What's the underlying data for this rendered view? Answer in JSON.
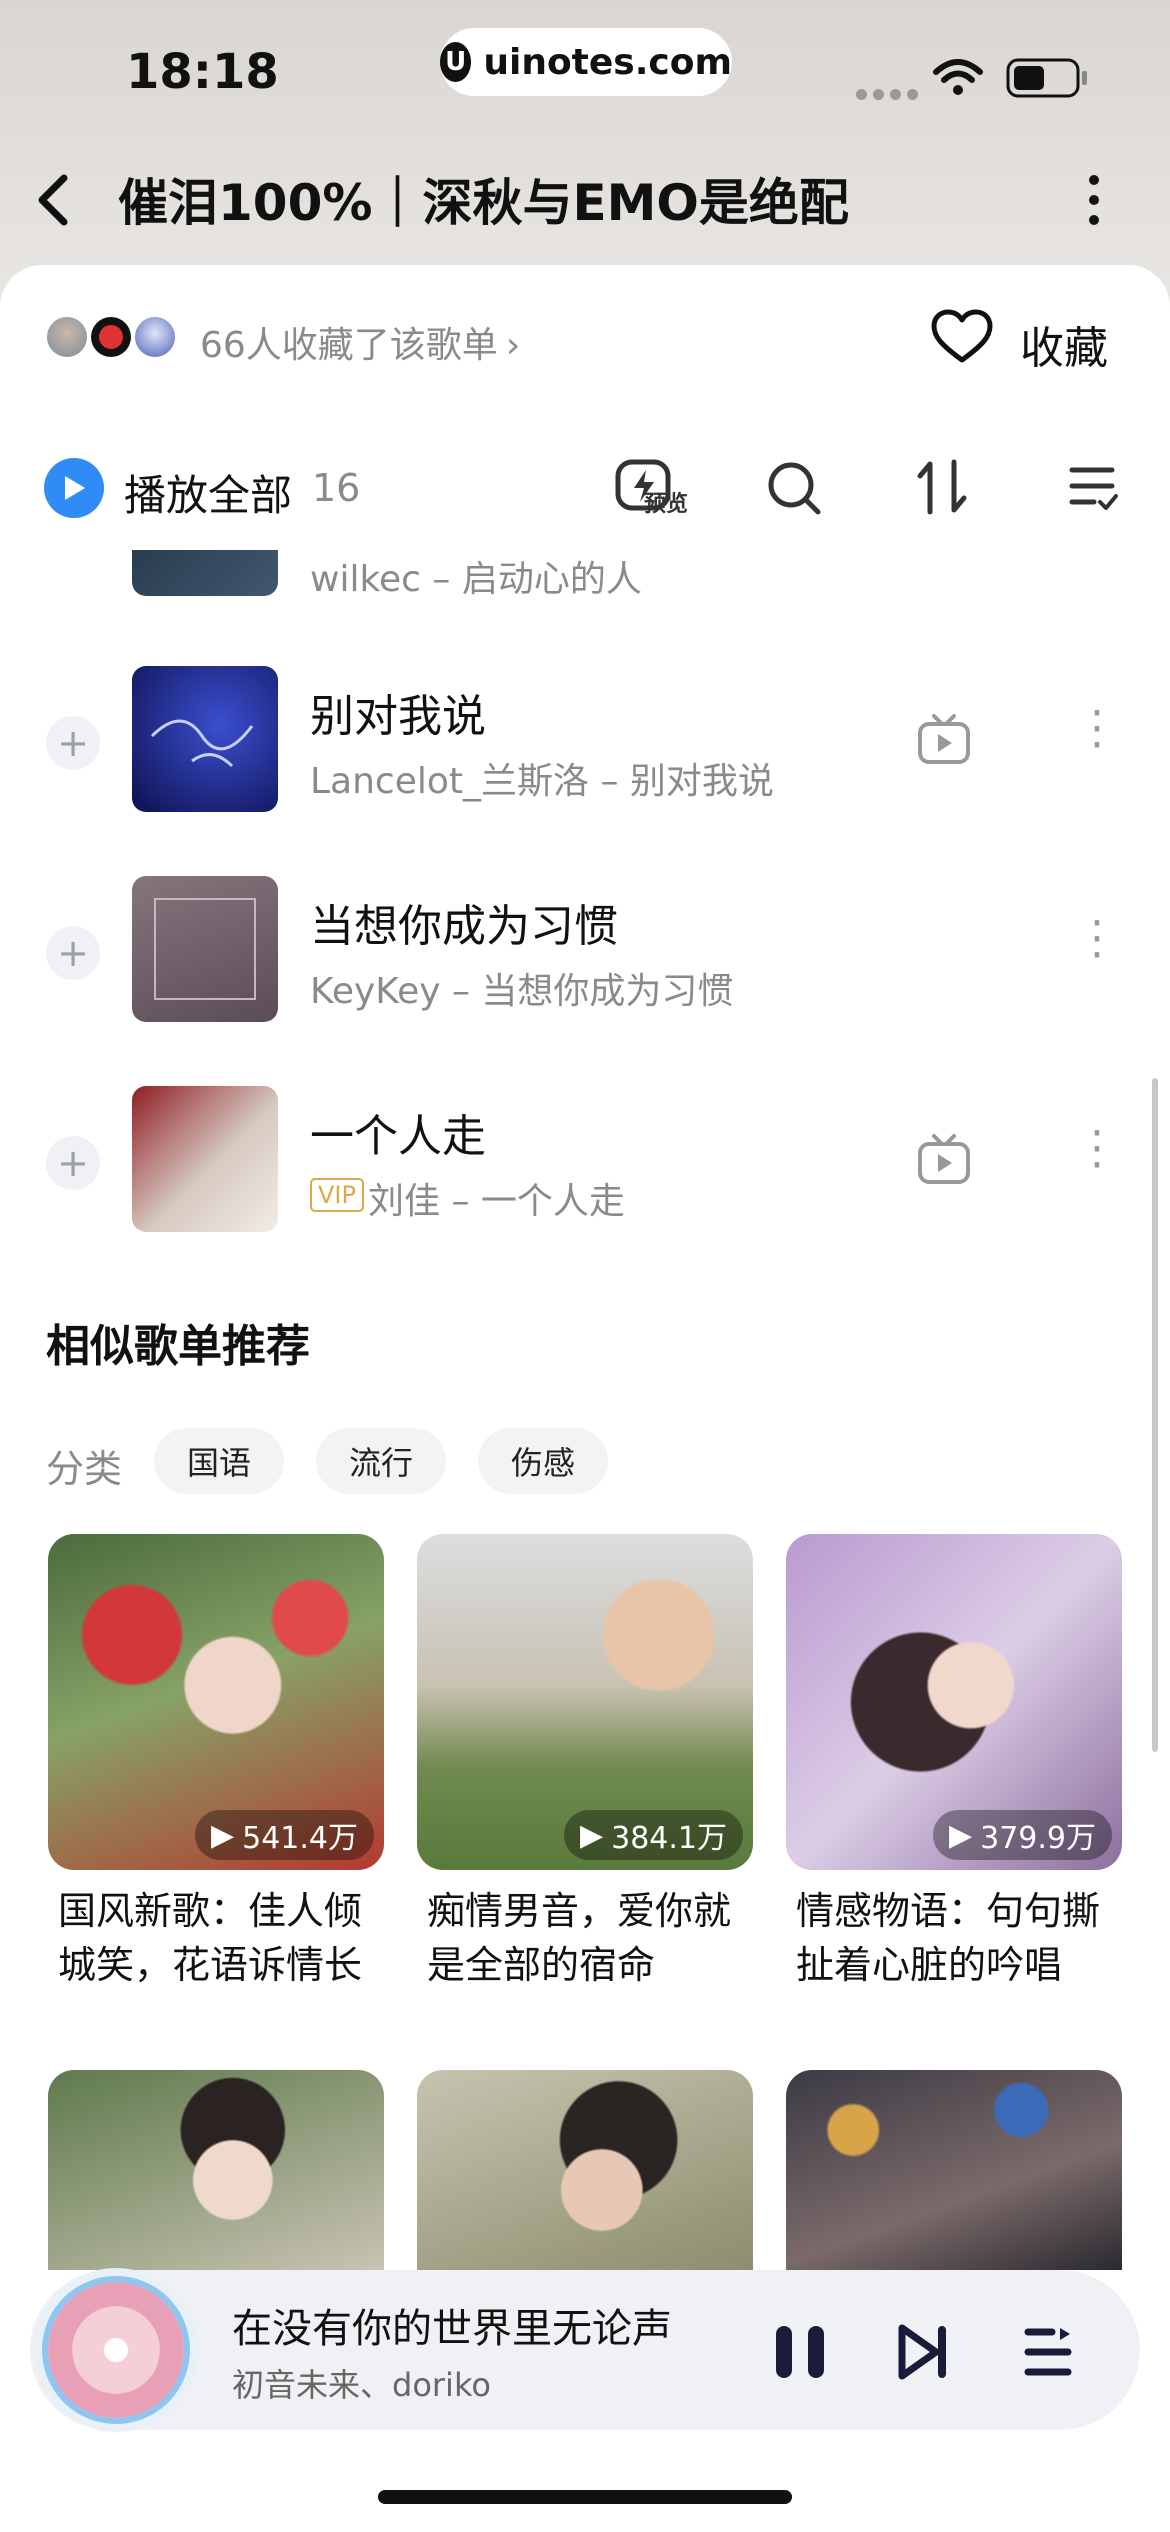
{
  "status_bar": {
    "time": "18:18",
    "site": "uinotes.com"
  },
  "header": {
    "title": "催泪100%｜深秋与EMO是绝配"
  },
  "collect": {
    "text": "66人收藏了该歌单",
    "favorite_label": "收藏"
  },
  "toolbar": {
    "play_all": "播放全部",
    "count": "16",
    "preview_label": "预览"
  },
  "songs": [
    {
      "title": "",
      "subtitle": "wilkec – 启动心的人",
      "has_mv": false
    },
    {
      "title": "别对我说",
      "subtitle": "Lancelot_兰斯洛 – 别对我说",
      "has_mv": true
    },
    {
      "title": "当想你成为习惯",
      "subtitle": "KeyKey – 当想你成为习惯",
      "has_mv": false
    },
    {
      "title": "一个人走",
      "subtitle": "刘佳 – 一个人走",
      "vip": "VIP",
      "has_mv": true
    }
  ],
  "recommend": {
    "title": "相似歌单推荐",
    "category_label": "分类",
    "tags": [
      "国语",
      "流行",
      "伤感"
    ],
    "playlists": [
      {
        "name": "国风新歌：佳人倾城笑，花语诉情长",
        "plays": "541.4万"
      },
      {
        "name": "痴情男音，爱你就是全部的宿命",
        "plays": "384.1万"
      },
      {
        "name": "情感物语：句句撕扯着心脏的吟唱",
        "plays": "379.9万"
      }
    ]
  },
  "player": {
    "song": "在没有你的世界里无论声",
    "artist": "初音未来、doriko"
  },
  "colors": {
    "accent": "#2f8cf5",
    "vip": "#d9a94a"
  }
}
